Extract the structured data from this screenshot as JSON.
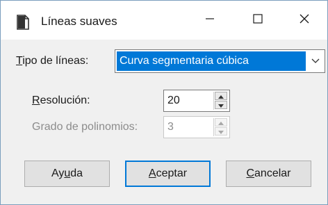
{
  "window": {
    "title": "Líneas suaves",
    "minimize_glyph": "—",
    "close_glyph": "✕"
  },
  "form": {
    "line_type": {
      "label_mnemonic": "T",
      "label_rest": "ipo de líneas:",
      "value": "Curva segmentaria cúbica"
    },
    "resolution": {
      "label_mnemonic": "R",
      "label_rest": "esolución:",
      "value": "20"
    },
    "polynomial_degree": {
      "label": "Grado de polinomios:",
      "value": "3"
    }
  },
  "buttons": {
    "help": {
      "before": "Ay",
      "mnemonic": "u",
      "after": "da"
    },
    "ok": {
      "before": "",
      "mnemonic": "A",
      "after": "ceptar"
    },
    "cancel": {
      "before": "",
      "mnemonic": "C",
      "after": "ancelar"
    }
  },
  "icons": {
    "title": "document-icon",
    "combo_arrow": "chevron-down-icon",
    "spin_up": "triangle-up-icon",
    "spin_down": "triangle-down-icon"
  },
  "colors": {
    "selection": "#0078d7",
    "default_button_border": "#0078d7",
    "dialog_bg": "#f0f0f0",
    "disabled_text": "#8c8c8c"
  }
}
